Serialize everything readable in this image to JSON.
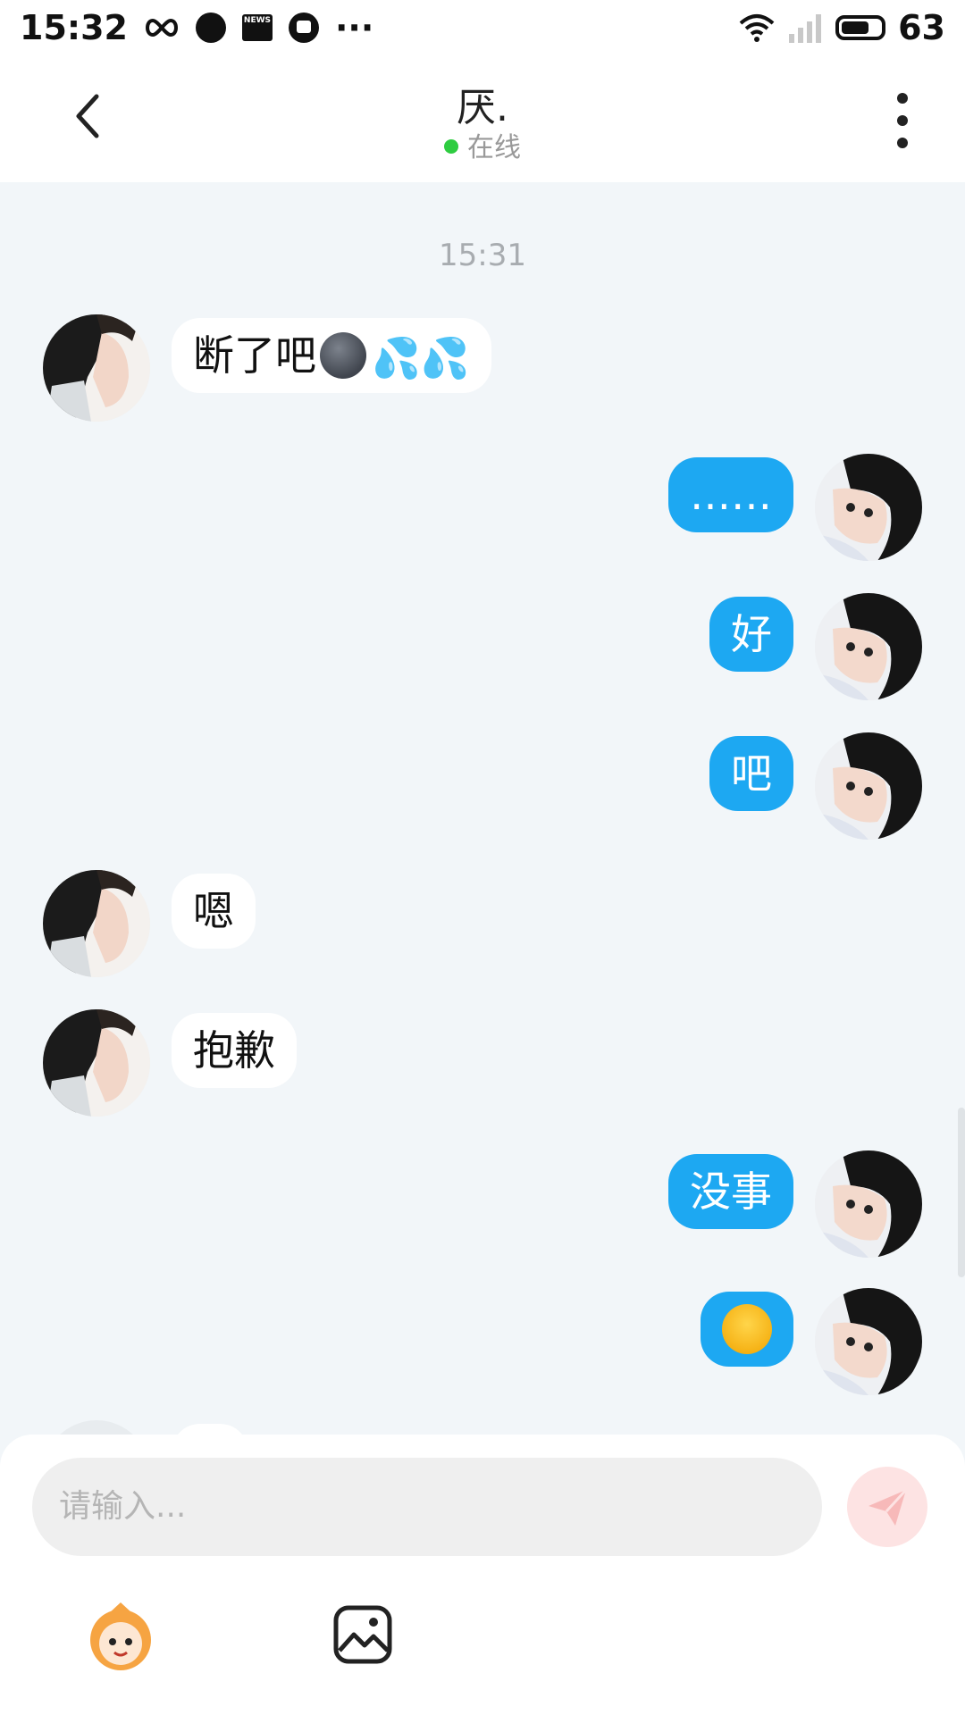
{
  "status_bar": {
    "time": "15:32",
    "battery": "63",
    "battery_level": 0.63,
    "icons": [
      "infinity-icon",
      "dark-dot-icon",
      "news-icon",
      "message-icon",
      "more-dots-icon",
      "wifi-icon",
      "signal-icon",
      "battery-icon"
    ]
  },
  "header": {
    "title": "厌.",
    "status": "在线",
    "status_color": "#2ecc40"
  },
  "chat": {
    "timestamp": "15:31",
    "messages": [
      {
        "side": "in",
        "text": "断了吧",
        "emojis": [
          "new-moon-face",
          "sweat-droplets",
          "sweat-droplets"
        ]
      },
      {
        "side": "out",
        "text": "……"
      },
      {
        "side": "out",
        "text": "好"
      },
      {
        "side": "out",
        "text": "吧"
      },
      {
        "side": "in",
        "text": "嗯"
      },
      {
        "side": "in",
        "text": "抱歉"
      },
      {
        "side": "out",
        "text": "没事"
      },
      {
        "side": "out",
        "emoji": "tears-of-joy"
      }
    ],
    "incoming_bubble_color": "#ffffff",
    "outgoing_bubble_color": "#1da8f2"
  },
  "composer": {
    "placeholder": "请输入...",
    "send_button_color": "#fde3e3"
  }
}
